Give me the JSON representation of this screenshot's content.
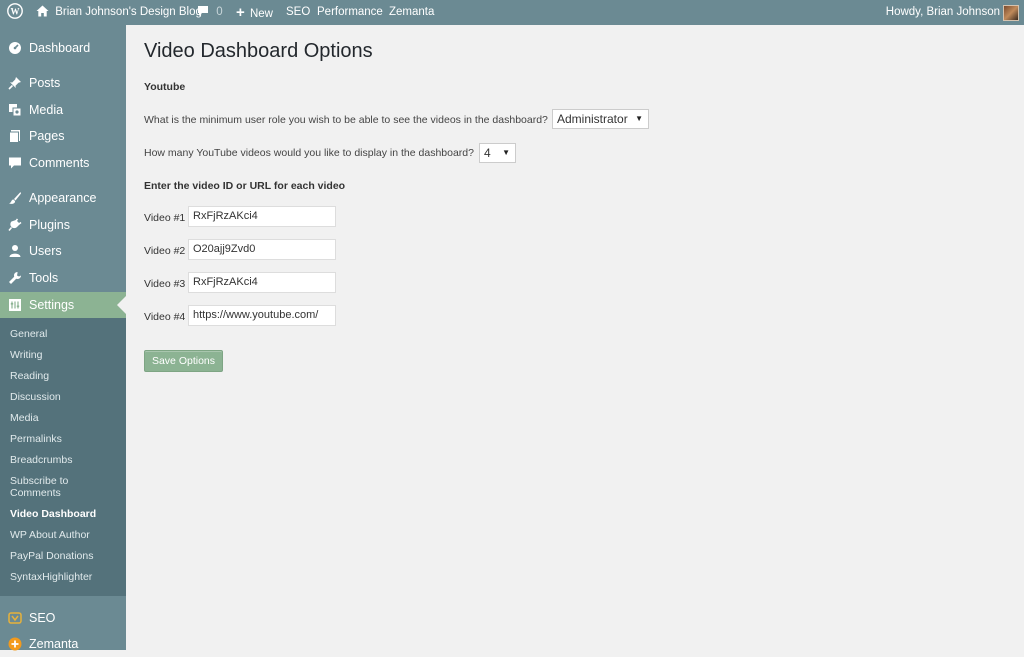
{
  "colors": {
    "admin_bar": "#6b8a93",
    "sidebar": "#6b8a93",
    "submenu": "#54727b",
    "accent": "#8cb393",
    "background": "#f1f1f1"
  },
  "admin_bar": {
    "site_name": "Brian Johnson's Design Blog",
    "comments_count": "0",
    "new_label": "New",
    "links": [
      "SEO",
      "Performance",
      "Zemanta"
    ],
    "greeting": "Howdy, Brian Johnson"
  },
  "sidebar": {
    "items": [
      {
        "label": "Dashboard",
        "icon": "dashboard-icon"
      },
      {
        "label": "Posts",
        "icon": "pin-icon"
      },
      {
        "label": "Media",
        "icon": "media-icon"
      },
      {
        "label": "Pages",
        "icon": "pages-icon"
      },
      {
        "label": "Comments",
        "icon": "comment-icon"
      },
      {
        "label": "Appearance",
        "icon": "brush-icon"
      },
      {
        "label": "Plugins",
        "icon": "plug-icon"
      },
      {
        "label": "Users",
        "icon": "user-icon"
      },
      {
        "label": "Tools",
        "icon": "wrench-icon"
      },
      {
        "label": "Settings",
        "icon": "settings-icon"
      },
      {
        "label": "SEO",
        "icon": "seo-icon"
      },
      {
        "label": "Zemanta",
        "icon": "zemanta-icon"
      }
    ],
    "submenu": [
      "General",
      "Writing",
      "Reading",
      "Discussion",
      "Media",
      "Permalinks",
      "Breadcrumbs",
      "Subscribe to Comments",
      "Video Dashboard",
      "WP About Author",
      "PayPal Donations",
      "SyntaxHighlighter"
    ]
  },
  "main": {
    "title": "Video Dashboard Options",
    "section": "Youtube",
    "role_question": "What is the minimum user role you wish to be able to see the videos in the dashboard?",
    "role_value": "Administrator",
    "count_question": "How many YouTube videos would you like to display in the dashboard?",
    "count_value": "4",
    "video_heading": "Enter the video ID or URL for each video",
    "videos": [
      {
        "label": "Video #1",
        "value": "RxFjRzAKci4"
      },
      {
        "label": "Video #2",
        "value": "O20ajj9Zvd0"
      },
      {
        "label": "Video #3",
        "value": "RxFjRzAKci4"
      },
      {
        "label": "Video #4",
        "value": "https://www.youtube.com/"
      }
    ],
    "save_label": "Save Options"
  }
}
